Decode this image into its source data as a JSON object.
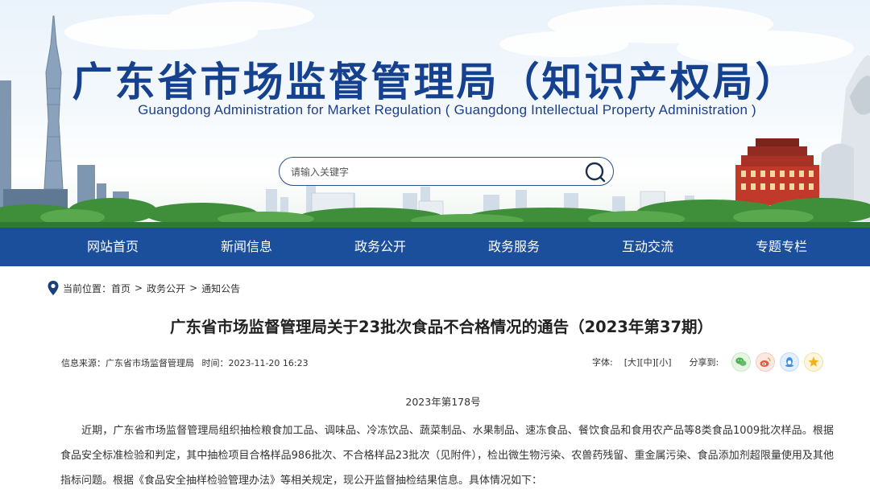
{
  "header": {
    "title_cn": "广东省市场监督管理局（知识产权局）",
    "title_en": "Guangdong Administration for Market Regulation ( Guangdong Intellectual Property Administration )",
    "colors": {
      "title": "#15418f",
      "nav_bg": "#1b4f9b"
    }
  },
  "search": {
    "placeholder": "请输入关键字",
    "icon": "search-icon"
  },
  "nav": {
    "items": [
      {
        "label": "网站首页"
      },
      {
        "label": "新闻信息"
      },
      {
        "label": "政务公开"
      },
      {
        "label": "政务服务"
      },
      {
        "label": "互动交流"
      },
      {
        "label": "专题专栏"
      }
    ]
  },
  "breadcrumb": {
    "icon": "location-pin-icon",
    "prefix": "当前位置：",
    "items": [
      {
        "label": "首页"
      },
      {
        "label": "政务公开"
      },
      {
        "label": "通知公告"
      }
    ],
    "separator": ">"
  },
  "article": {
    "title": "广东省市场监督管理局关于23批次食品不合格情况的通告（2023年第37期）",
    "source_label": "信息来源：",
    "source": "广东省市场监督管理局",
    "time_label": "时间：",
    "time": "2023-11-20 16:23",
    "font_label": "字体:",
    "font_sizes": [
      "[大]",
      "[中]",
      "[小]"
    ],
    "share_label": "分享到:",
    "share_icons": [
      "wechat-icon",
      "weibo-icon",
      "qq-icon",
      "favorite-icon"
    ],
    "doc_number": "2023年第178号",
    "paragraph": "近期，广东省市场监督管理局组织抽检粮食加工品、调味品、冷冻饮品、蔬菜制品、水果制品、速冻食品、餐饮食品和食用农产品等8类食品1009批次样品。根据食品安全标准检验和判定，其中抽检项目合格样品986批次、不合格样品23批次（见附件），检出微生物污染、农兽药残留、重金属污染、食品添加剂超限量使用及其他指标问题。根据《食品安全抽样检验管理办法》等相关规定，现公开监督抽检结果信息。具体情况如下："
  }
}
